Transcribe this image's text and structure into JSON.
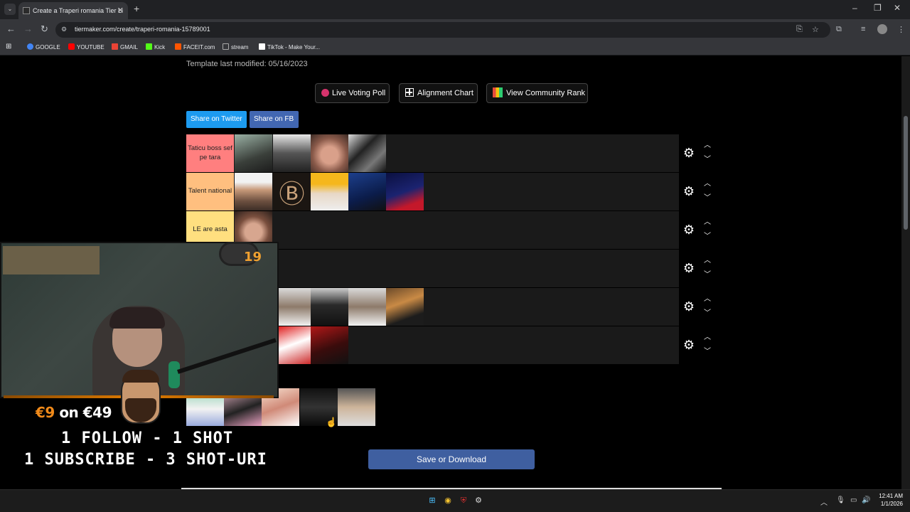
{
  "browser": {
    "tab_title": "Create a Traperi romania Tier Li",
    "url": "tiermaker.com/create/traperi-romania-15789001",
    "new_tab": "+",
    "close": "✕",
    "bookmarks": [
      {
        "label": "GOOGLE",
        "color": "#4285f4"
      },
      {
        "label": "YOUTUBE",
        "color": "#ff0000"
      },
      {
        "label": "GMAIL",
        "color": "#ea4335"
      },
      {
        "label": "Kick",
        "color": "#53fc18"
      },
      {
        "label": "FACEIT.com",
        "color": "#ff5500"
      },
      {
        "label": "stream",
        "color": "#aaaaaa"
      },
      {
        "label": "TikTok - Make Your...",
        "color": "#ffffff"
      }
    ]
  },
  "page": {
    "modified": "Template last modified: 05/16/2023",
    "buttons": {
      "live_poll": "Live Voting Poll",
      "alignment": "Alignment Chart",
      "community": "View Community Rank"
    },
    "share_twitter": "Share on Twitter",
    "share_fb": "Share on FB",
    "tiers": [
      {
        "label": "Taticu boss sef pe tara",
        "color": "#ff7f7f"
      },
      {
        "label": "Talent national",
        "color": "#ffbf7f"
      },
      {
        "label": "LE are asta",
        "color": "#ffdf7f"
      },
      {
        "label": "",
        "color": "#ffff7f"
      },
      {
        "label": "",
        "color": "#bfff7f"
      },
      {
        "label": "",
        "color": "#7fff7f"
      }
    ],
    "save": "Save or Download"
  },
  "overlay": {
    "badge": "19",
    "donate_amount": "€9",
    "donate_on": "on",
    "donate_goal": "€49",
    "line1": "1 FOLLOW - 1 SHOT",
    "line2": "1 SUBSCRIBE - 3 SHOT-URI"
  },
  "taskbar": {
    "time": "12:41 AM",
    "date": "1/1/2026"
  }
}
